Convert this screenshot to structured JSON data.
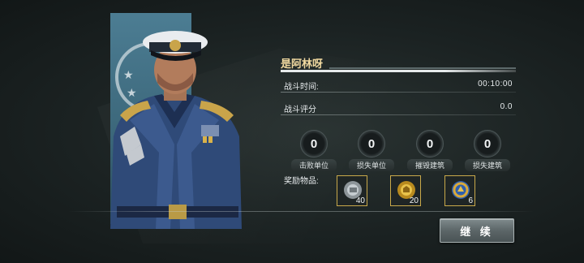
{
  "result": {
    "player_name": "是阿林呀",
    "battle_time_label": "战斗时间:",
    "battle_time_value": "00:10:00",
    "battle_score_label": "战斗评分",
    "battle_score_value": "0.0"
  },
  "counters": [
    {
      "value": "0",
      "label": "击败单位"
    },
    {
      "value": "0",
      "label": "损失单位"
    },
    {
      "value": "0",
      "label": "摧毁建筑"
    },
    {
      "value": "0",
      "label": "损失建筑"
    }
  ],
  "rewards": {
    "label": "奖励物品:",
    "items": [
      {
        "icon": "silver-resource-icon",
        "count": "40"
      },
      {
        "icon": "gold-resource-icon",
        "count": "20"
      },
      {
        "icon": "gem-resource-icon",
        "count": "6"
      }
    ]
  },
  "actions": {
    "continue_label": "继 续"
  },
  "colors": {
    "banner": "#4c7d93",
    "name": "#f1d9a0",
    "reward_border": "#c9a94a"
  }
}
